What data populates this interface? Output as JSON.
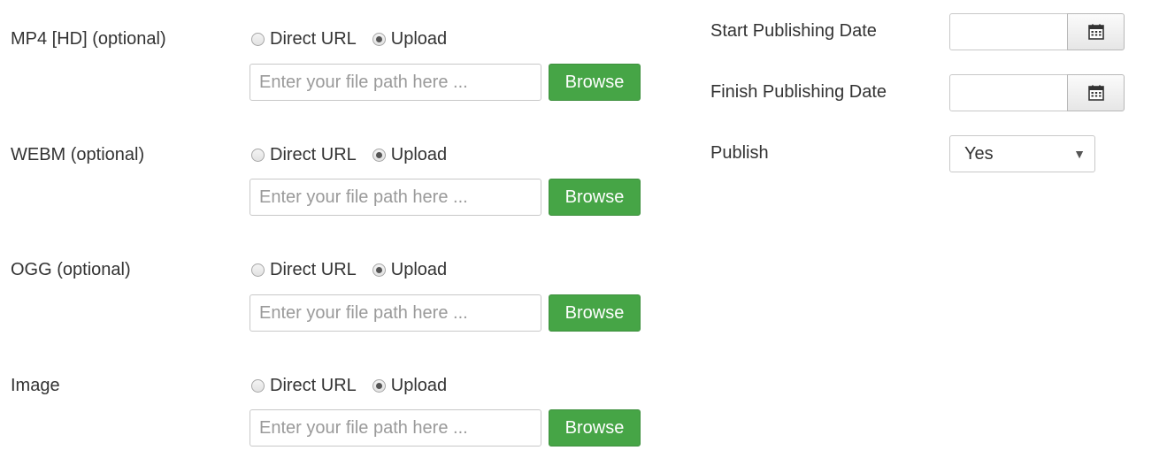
{
  "media_fields": [
    {
      "label": "MP4 [HD] (optional)",
      "radio_direct": "Direct URL",
      "radio_upload": "Upload",
      "selected": "upload",
      "placeholder": "Enter your file path here ...",
      "button": "Browse"
    },
    {
      "label": "WEBM (optional)",
      "radio_direct": "Direct URL",
      "radio_upload": "Upload",
      "selected": "upload",
      "placeholder": "Enter your file path here ...",
      "button": "Browse"
    },
    {
      "label": "OGG (optional)",
      "radio_direct": "Direct URL",
      "radio_upload": "Upload",
      "selected": "upload",
      "placeholder": "Enter your file path here ...",
      "button": "Browse"
    },
    {
      "label": "Image",
      "radio_direct": "Direct URL",
      "radio_upload": "Upload",
      "selected": "upload",
      "placeholder": "Enter your file path here ...",
      "button": "Browse"
    }
  ],
  "publishing": {
    "start_label": "Start Publishing Date",
    "start_value": "",
    "finish_label": "Finish Publishing Date",
    "finish_value": "",
    "calendar_icon": "calendar-icon",
    "publish_label": "Publish",
    "publish_value": "Yes",
    "dropdown_icon": "caret-down-icon"
  },
  "colors": {
    "browse_button": "#46a546",
    "text": "#333333",
    "placeholder": "#9a9a9a"
  }
}
